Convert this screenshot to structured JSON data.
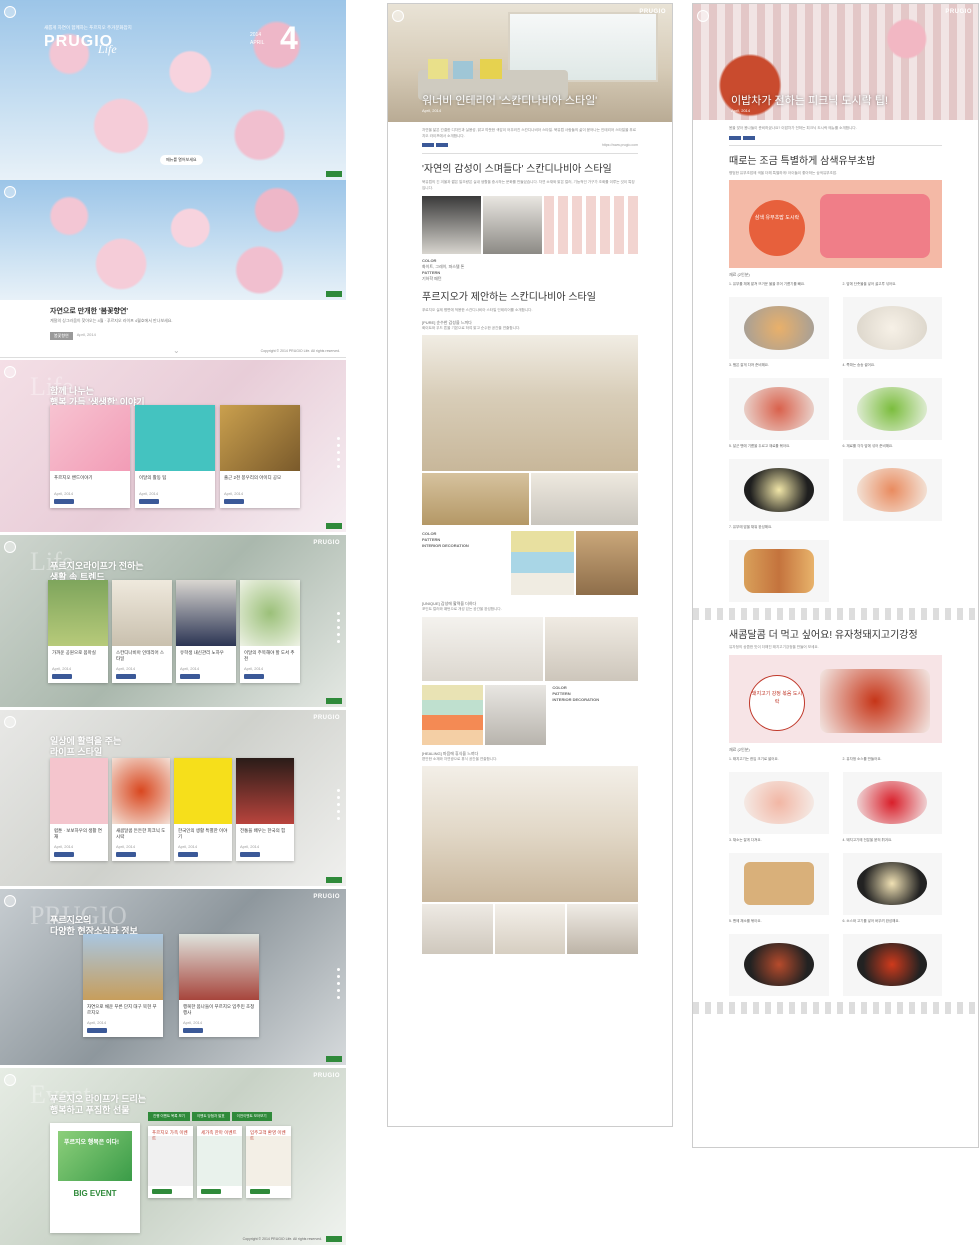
{
  "col1": {
    "cover": {
      "tagline": "새롭게 자연이 함께하는 푸르지오 주거문화잡지",
      "brand": "PRUGIO",
      "brand_script": "Life",
      "year": "2014",
      "month_word": "APRIL",
      "issue": "4",
      "button": "메뉴를 열어보세요"
    },
    "intro": {
      "title": "자연으로 만개한 '봄꽃향연'",
      "desc": "계절의 싱그러움이 찾아오는 4월 · 푸르지오 라이프 4월호에서 만나보세요.",
      "tags": [
        "봄꽃향연",
        "April, 2014"
      ]
    },
    "sec1": {
      "ghost": "Life",
      "title_l1": "함께 나누는",
      "title_l2": "행복 가득 '생생한' 이야기",
      "cards": [
        {
          "t": "푸르지오 밴드이야기",
          "d": "April, 2014"
        },
        {
          "t": "이달의 활동 팁",
          "d": "April, 2014"
        },
        {
          "t": "출근 2천 봉우리의 아이디 공모",
          "d": "April, 2014"
        }
      ]
    },
    "sec2": {
      "ghost": "Life",
      "title_l1": "푸르지오라이프가 전하는",
      "title_l2": "생활 속 트렌드",
      "cards": [
        {
          "t": "가까운 공원으로 봄마실",
          "d": "April, 2014"
        },
        {
          "t": "스칸디나비아 인테리어 스타일",
          "d": "April, 2014"
        },
        {
          "t": "유학생 내신관리 노하우",
          "d": "April, 2014"
        },
        {
          "t": "이달의 주목해야 할 도서 추천",
          "d": "April, 2014"
        }
      ]
    },
    "sec3": {
      "title_l1": "일상에 활력을 주는",
      "title_l2": "라이프 스타일",
      "cards": [
        {
          "t": "럽툰 · 보보하우의 생활 연재",
          "d": "April, 2014"
        },
        {
          "t": "새콤달콤 든든한 피크닉 도시락",
          "d": "April, 2014"
        },
        {
          "t": "한국인의 생활 특별한 이야기",
          "d": "April, 2014"
        },
        {
          "t": "전통을 배우는 한국의 힘",
          "d": "April, 2014"
        }
      ]
    },
    "sec4": {
      "ghost": "PRUGIO",
      "title_l1": "푸르지오의",
      "title_l2": "다양한 현장소식과 정보",
      "cards": [
        {
          "t": "자연으로 채운 푸른 단지 대구 북현 푸르지오",
          "d": "April, 2014"
        },
        {
          "t": "행복한 봄나들이 푸르지오 입주민 초청 행사",
          "d": "April, 2014"
        }
      ]
    },
    "sec5": {
      "ghost": "Event",
      "title_l1": "푸르지오 라이프가 드리는",
      "title_l2": "행복하고 푸짐한 선물",
      "tabs": [
        "진행 이벤트 목록 보기",
        "이벤트 당첨자 발표",
        "이전이벤트 모아보기"
      ],
      "big_event": "BIG EVENT",
      "box_text": "푸르지오 행복은 이다!",
      "cards": [
        {
          "t": "푸르지오 가족 이벤트"
        },
        {
          "t": "세가족 한마 이벤트"
        },
        {
          "t": "입주고객 환영 이벤트"
        }
      ]
    },
    "copyright": "Copyright © 2014 PRUGIO Life. All rights reserved."
  },
  "col2": {
    "hero_title": "워너비 인테리어 '스칸디나비아 스타일'",
    "hero_sub": "April, 2014",
    "intro": "자연을 닮은 간결한 디자인과 실용성, 밝고 따뜻한 색감이 어우러진 스칸디나비아 스타일. 북유럽 사람들의 삶이 묻어나는 인테리어 스타일을 푸르지오 라이프에서 소개합니다.",
    "h1": "'자연의 감성이 스며들다' 스칸디나비아 스타일",
    "p1": "북유럽의 긴 겨울과 짧은 일조량은 실내 생활을 중시하는 문화를 만들었습니다. 자연 소재와 밝은 컬러, 기능적인 가구가 조화를 이루는 것이 특징입니다.",
    "color_label": "COLOR",
    "color_text": "화이트, 그레이, 파스텔 톤",
    "pattern_label": "PATTERN",
    "pattern_text": "기하학 패턴",
    "h2": "푸르지오가 제안하는 스칸디나비아 스타일",
    "p2": "푸르지오 실제 평면에 적용한 스칸디나비아 스타일 인테리어를 소개합니다.",
    "s1": "[PURE] 순수한 감성을 느끼다",
    "s1p": "화이트와 우드 톤을 기본으로 하여 밝고 순수한 공간을 연출합니다.",
    "s2": "[UNIQUE] 감성에 활력을 더하다",
    "s2p": "포인트 컬러와 패턴으로 개성 있는 공간을 완성합니다.",
    "s3": "[HEALING] 마음에 휴식을 느끼다",
    "s3p": "편안한 소재와 자연광으로 휴식 공간을 연출합니다.",
    "interior_label": "INTERIOR DECORATION",
    "share": "https://www.prugio.com"
  },
  "col3": {
    "hero_title": "이밥차가 전하는 피크닉 도시락 팁!",
    "hero_sub": "April, 2014",
    "intro": "봄을 맞아 봄나들이 준비하셨나요? 이밥차가 전하는 피크닉 도시락 메뉴를 소개합니다.",
    "h1": "때로는 조금 특별하게 삼색유부초밥",
    "p1": "평범한 유부초밥에 색을 더해 특별하게! 아이들이 좋아하는 삼색유부초밥.",
    "badge": "삼색 유부초밥 도시락",
    "ing_title": "재료 (2인분)",
    "steps1": [
      "1. 유부를 체에 밭쳐 뜨거운 물을 부어 기름기를 빼요.",
      "2. 밥에 단촛물을 넣어 골고루 섞어요.",
      "3. 햄은 잘게 다져 준비해요.",
      "4. 쪽파는 송송 썰어요.",
      "5. 달군 팬에 기름을 두르고 재료를 볶아요.",
      "6. 재료를 각각 밥에 섞어 준비해요.",
      "7. 유부에 밥을 채워 완성해요."
    ],
    "h2": "새콤달콤 더 먹고 싶어요! 유자청돼지고기강정",
    "p2": "유자청의 상큼한 맛이 더해진 돼지고기강정을 만들어 보세요.",
    "badge2": "돼지고기 강정 볶음 도시락",
    "ing_title2": "재료 (2인분)",
    "steps2": [
      "1. 돼지고기는 한입 크기로 썰어요.",
      "2. 유자청 소스를 만들어요.",
      "3. 채소는 잘게 다져요.",
      "4. 돼지고기에 전분을 묻혀 튀겨요.",
      "5. 팬에 채소를 볶아요.",
      "6. 소스와 고기를 넣어 버무려 완성해요."
    ]
  }
}
